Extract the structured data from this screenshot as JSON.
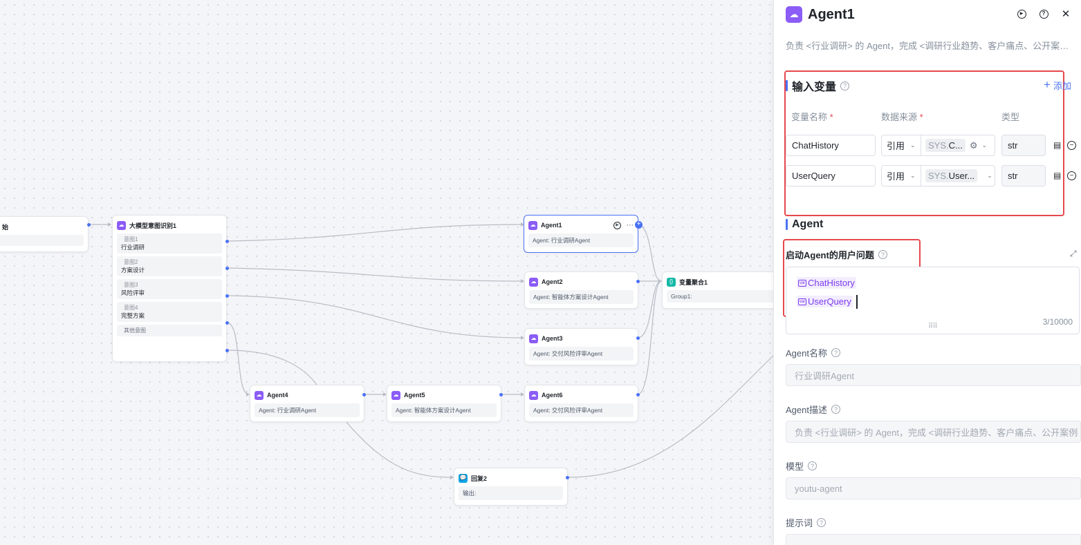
{
  "canvas": {
    "partial_node": {
      "title": "始"
    },
    "intent_node": {
      "title": "大模型意图识别1",
      "intents": [
        {
          "label": "意图1",
          "value": "行业调研"
        },
        {
          "label": "意图2",
          "value": "方案设计"
        },
        {
          "label": "意图3",
          "value": "风险评审"
        },
        {
          "label": "意图4",
          "value": "完整方案"
        }
      ],
      "other": "其他意图"
    },
    "agents": [
      {
        "title": "Agent1",
        "body": "Agent: 行业调研Agent"
      },
      {
        "title": "Agent2",
        "body": "Agent: 智能体方案设计Agent"
      },
      {
        "title": "Agent3",
        "body": "Agent: 交付风险评审Agent"
      },
      {
        "title": "Agent4",
        "body": "Agent: 行业调研Agent"
      },
      {
        "title": "Agent5",
        "body": "Agent: 智能体方案设计Agent"
      },
      {
        "title": "Agent6",
        "body": "Agent: 交付风险评审Agent"
      }
    ],
    "aggregate_node": {
      "title": "变量聚合1",
      "body": "Group1:"
    },
    "reply_node": {
      "title": "回复2",
      "body": "输出:"
    }
  },
  "panel": {
    "title": "Agent1",
    "description": "负责 <行业调研> 的 Agent，完成 <调研行业趋势、客户痛点、公开案例...",
    "input_vars": {
      "title": "输入变量",
      "add_label": "添加",
      "col_name": "变量名称",
      "col_source": "数据来源",
      "col_type": "类型",
      "rows": [
        {
          "name": "ChatHistory",
          "source_mode": "引用",
          "sys_prefix": "SYS.",
          "sys_value": "C...",
          "type": "str"
        },
        {
          "name": "UserQuery",
          "source_mode": "引用",
          "sys_prefix": "SYS.",
          "sys_value": "User...",
          "type": "str"
        }
      ]
    },
    "agent_section": {
      "title": "Agent",
      "query_label": "启动Agent的用户问题",
      "query_vars": [
        "ChatHistory",
        "UserQuery"
      ],
      "counter": "3/10000",
      "name_label": "Agent名称",
      "name_value": "行业调研Agent",
      "desc_label": "Agent描述",
      "desc_value": "负责 <行业调研> 的 Agent，完成 <调研行业趋势、客户痛点、公开案例",
      "model_label": "模型",
      "model_value": "youtu-agent",
      "prompt_label": "提示词"
    }
  },
  "colors": {
    "accent": "#4a72f5",
    "agent_icon": "#8b5cf6",
    "highlight": "#e5484d",
    "var_tag": "#7c3aed"
  }
}
